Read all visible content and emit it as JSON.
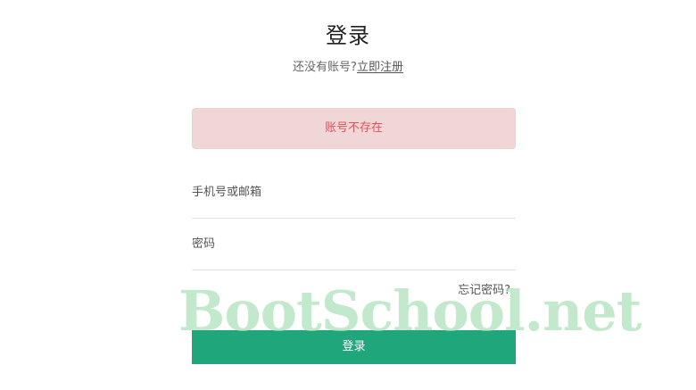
{
  "page": {
    "title": "登录",
    "subtitle_prefix": "还没有账号?",
    "register_link": "立即注册"
  },
  "alert": {
    "message": "账号不存在",
    "color": "#e0525b",
    "background": "#f1d6d7"
  },
  "form": {
    "account_placeholder": "手机号或邮箱",
    "account_value": "",
    "password_placeholder": "密码",
    "password_value": "",
    "forgot_label": "忘记密码?",
    "submit_label": "登录"
  },
  "colors": {
    "primary": "#1fa67a",
    "watermark": "#aae1b9"
  },
  "watermark": {
    "text": "BootSchool.net"
  }
}
